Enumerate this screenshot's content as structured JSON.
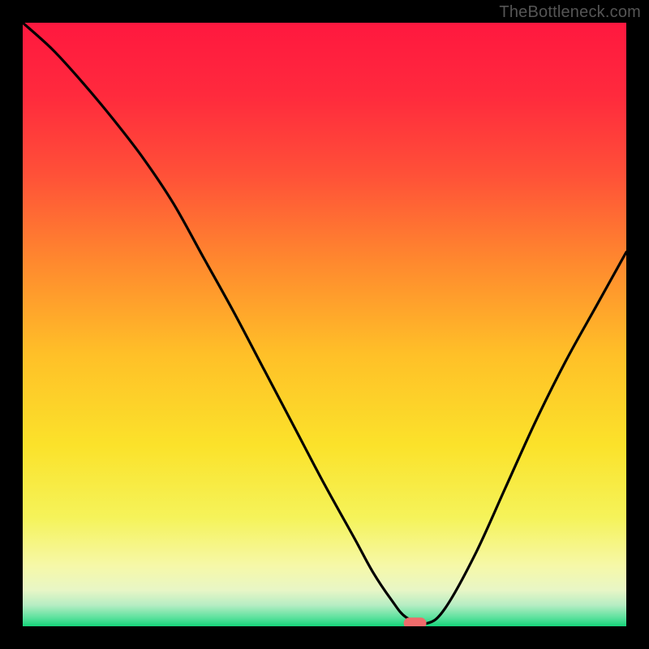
{
  "watermark": "TheBottleneck.com",
  "colors": {
    "gradient_stops": [
      {
        "offset": 0.0,
        "color": "#ff183f"
      },
      {
        "offset": 0.12,
        "color": "#ff2a3d"
      },
      {
        "offset": 0.25,
        "color": "#ff5038"
      },
      {
        "offset": 0.4,
        "color": "#ff8a2e"
      },
      {
        "offset": 0.55,
        "color": "#ffc028"
      },
      {
        "offset": 0.7,
        "color": "#fbe22a"
      },
      {
        "offset": 0.82,
        "color": "#f5f35a"
      },
      {
        "offset": 0.9,
        "color": "#f6f8a8"
      },
      {
        "offset": 0.94,
        "color": "#e8f6c6"
      },
      {
        "offset": 0.965,
        "color": "#b6edc3"
      },
      {
        "offset": 0.985,
        "color": "#5fe29f"
      },
      {
        "offset": 1.0,
        "color": "#15d47a"
      }
    ],
    "marker": "#ef6b6b",
    "curve": "#000000",
    "frame": "#000000"
  },
  "chart_data": {
    "type": "line",
    "title": "",
    "xlabel": "",
    "ylabel": "",
    "xlim": [
      0,
      100
    ],
    "ylim": [
      0,
      100
    ],
    "grid": false,
    "legend": false,
    "series": [
      {
        "name": "bottleneck_curve",
        "x": [
          0,
          5,
          10,
          15,
          20,
          25,
          30,
          35,
          40,
          45,
          50,
          55,
          58,
          61,
          63.5,
          67,
          70,
          75,
          80,
          85,
          90,
          95,
          100
        ],
        "y": [
          100,
          95.5,
          90,
          84,
          77.5,
          70,
          61,
          52,
          42.5,
          33,
          23.5,
          14.5,
          9,
          4.5,
          1.5,
          0.5,
          3,
          12,
          23,
          34,
          44,
          53,
          62
        ]
      }
    ],
    "marker": {
      "x": 65,
      "y": 0.5,
      "shape": "pill"
    },
    "notes": "Values estimated from pixels; origin at bottom-left of gradient area. 100 on y-axis = top of gradient, 0 = bottom."
  }
}
